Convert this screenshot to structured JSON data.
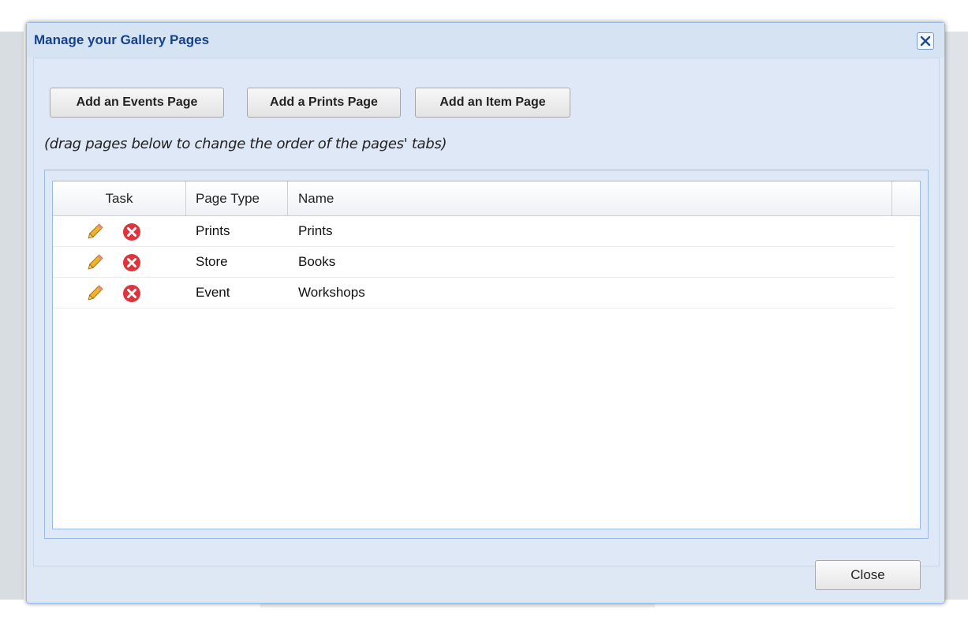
{
  "dialog": {
    "title": "Manage your Gallery Pages",
    "close_icon": "close-icon"
  },
  "toolbar": {
    "add_events_label": "Add an Events Page",
    "add_prints_label": "Add a Prints Page",
    "add_item_label": "Add an Item Page"
  },
  "hint": "(drag pages below to change the order of the pages' tabs)",
  "grid": {
    "columns": [
      "Task",
      "Page Type",
      "Name"
    ],
    "rows": [
      {
        "page_type": "Prints",
        "name": "Prints"
      },
      {
        "page_type": "Store",
        "name": "Books"
      },
      {
        "page_type": "Event",
        "name": "Workshops"
      }
    ]
  },
  "footer": {
    "close_label": "Close"
  },
  "colors": {
    "title": "#15428b",
    "dialog_bg": "#dee8f4",
    "border": "#99bbe8",
    "delete_icon": "#e0343c",
    "edit_icon": "#f0b429"
  }
}
